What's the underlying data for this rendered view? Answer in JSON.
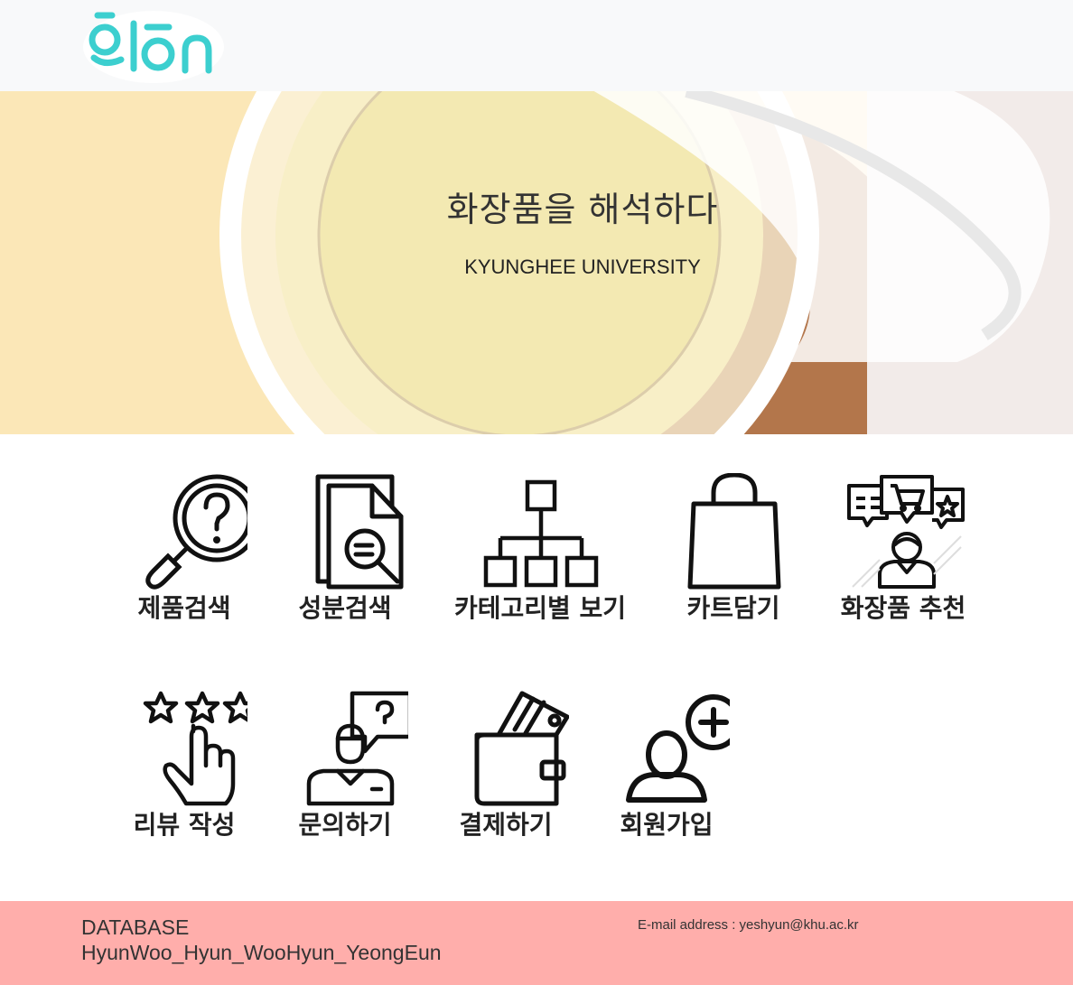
{
  "logo": {
    "alt": "olon",
    "color": "#3ccfcf"
  },
  "hero": {
    "title": "화장품을 해석하다",
    "subtitle": "KYUNGHEE UNIVERSITY"
  },
  "menu": [
    {
      "label": "제품검색",
      "icon": "magnifier-question-icon"
    },
    {
      "label": "성분검색",
      "icon": "document-search-icon"
    },
    {
      "label": "카테고리별 보기",
      "icon": "hierarchy-icon"
    },
    {
      "label": "카트담기",
      "icon": "shopping-bag-icon"
    },
    {
      "label": "화장품 추천",
      "icon": "recommendation-icon"
    },
    {
      "label": "리뷰 작성",
      "icon": "rating-hand-icon"
    },
    {
      "label": "문의하기",
      "icon": "inquiry-person-icon"
    },
    {
      "label": "결제하기",
      "icon": "wallet-icon"
    },
    {
      "label": "회원가입",
      "icon": "add-user-icon"
    }
  ],
  "footer": {
    "title": "DATABASE",
    "team": "HyunWoo_Hyun_WooHyun_YeongEun",
    "email": "E-mail address : yeshyun@khu.ac.kr"
  },
  "colors": {
    "header_bg": "#f8f9fa",
    "footer_bg": "#ffaeab",
    "logo": "#3ccfcf"
  }
}
